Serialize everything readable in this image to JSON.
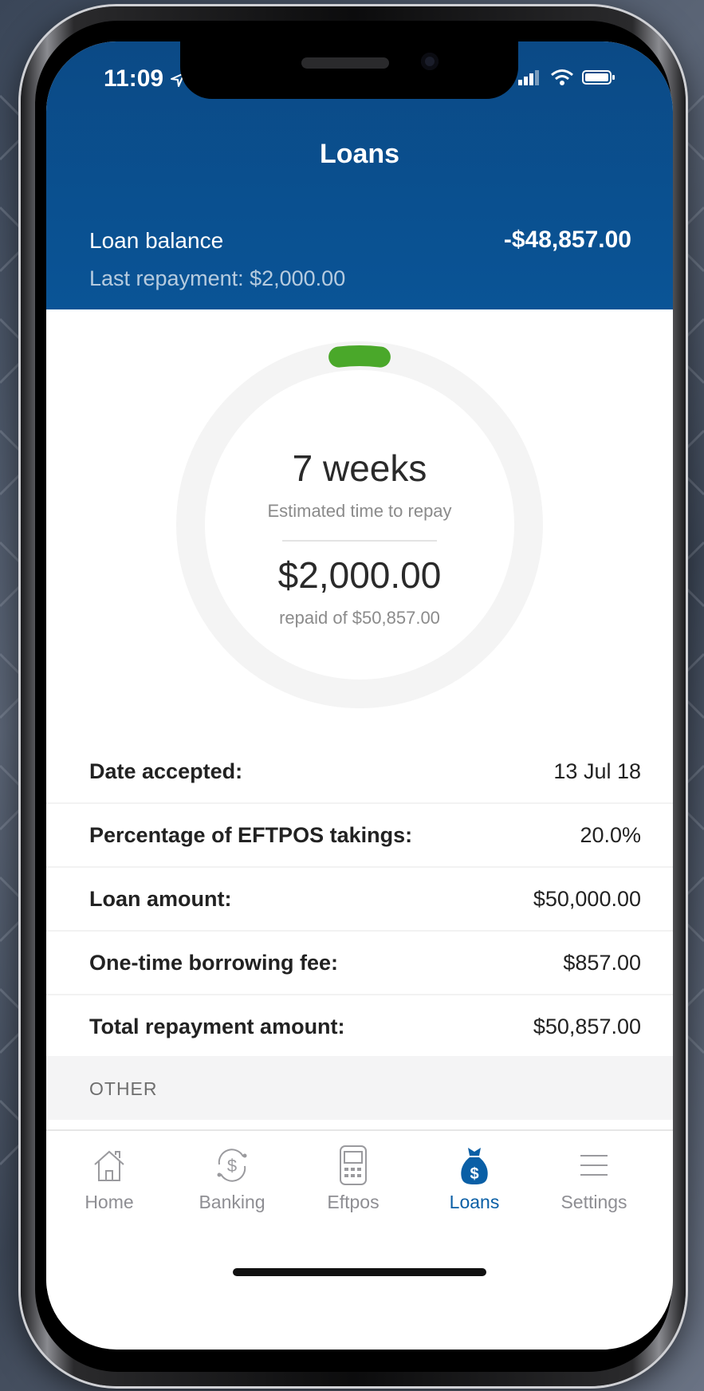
{
  "status": {
    "time": "11:09"
  },
  "nav": {
    "title": "Loans"
  },
  "summary": {
    "balance_label": "Loan balance",
    "balance_value": "-$48,857.00",
    "last_repayment": "Last repayment: $2,000.00"
  },
  "progress": {
    "repaid_fraction": 0.039,
    "weeks": "7 weeks",
    "weeks_caption": "Estimated time to repay",
    "repaid_amount": "$2,000.00",
    "repaid_caption": "repaid of $50,857.00",
    "track_color": "#f4f4f4",
    "fill_color": "#4aa82a"
  },
  "details": [
    {
      "label": "Date accepted:",
      "value": "13 Jul 18"
    },
    {
      "label": "Percentage of EFTPOS takings:",
      "value": "20.0%"
    },
    {
      "label": "Loan amount:",
      "value": "$50,000.00"
    },
    {
      "label": "One-time borrowing fee:",
      "value": "$857.00"
    },
    {
      "label": "Total repayment amount:",
      "value": "$50,857.00"
    }
  ],
  "other_section": {
    "label": "OTHER"
  },
  "tabs": [
    {
      "label": "Home",
      "icon": "home-icon"
    },
    {
      "label": "Banking",
      "icon": "banking-icon"
    },
    {
      "label": "Eftpos",
      "icon": "eftpos-terminal-icon"
    },
    {
      "label": "Loans",
      "icon": "money-bag-icon",
      "active": true
    },
    {
      "label": "Settings",
      "icon": "menu-lines-icon"
    }
  ],
  "colors": {
    "header": "#0a5496",
    "accent": "#0a5fa6",
    "progress": "#4aa82a"
  }
}
